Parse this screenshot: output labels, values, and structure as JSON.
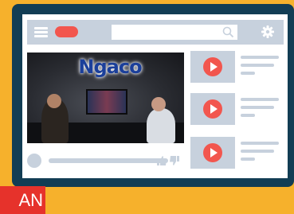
{
  "colors": {
    "background": "#f6b12c",
    "frame": "#123d54",
    "placeholder_gray": "#c7d1dd",
    "accent_red": "#f2564e",
    "badge_red": "#e6322b"
  },
  "video": {
    "logo_text": "Ngaco"
  },
  "badge": {
    "text": "AN"
  },
  "icons": [
    "menu-icon",
    "search-icon",
    "gear-icon",
    "like-icon",
    "dislike-icon",
    "play-icon"
  ]
}
